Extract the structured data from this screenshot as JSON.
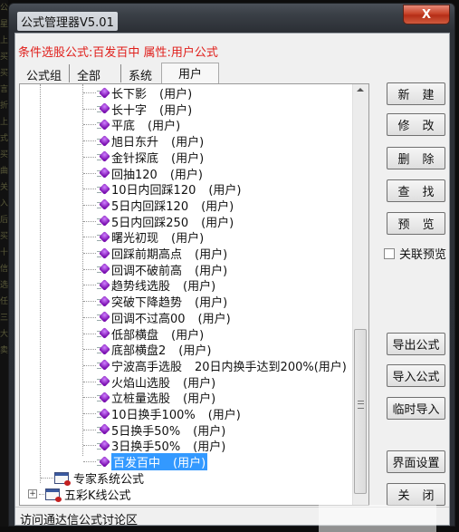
{
  "background_text": [
    "公",
    "星",
    "上",
    "买",
    "买",
    "言",
    "折",
    "上",
    "式",
    "买",
    "曲",
    "关",
    "入",
    "后",
    "买",
    "十",
    "信",
    "选",
    "任",
    "三",
    "大",
    "卖"
  ],
  "window": {
    "title": "公式管理器V5.01",
    "close_label": "X"
  },
  "condition_line": "条件选股公式:百发百中  属性:用户公式",
  "tabs": [
    {
      "label": "公式组"
    },
    {
      "label": "全部"
    },
    {
      "label": "系统"
    },
    {
      "label": "用户",
      "active": true
    }
  ],
  "tree": {
    "items": [
      {
        "name": "长下影",
        "tag": "(用户)"
      },
      {
        "name": "长十字",
        "tag": "(用户)"
      },
      {
        "name": "平底",
        "tag": "(用户)"
      },
      {
        "name": "旭日东升",
        "tag": "(用户)"
      },
      {
        "name": "金针探底",
        "tag": "(用户)"
      },
      {
        "name": "回抽120",
        "tag": "(用户)"
      },
      {
        "name": "10日内回踩120",
        "tag": "(用户)"
      },
      {
        "name": "5日内回踩120",
        "tag": "(用户)"
      },
      {
        "name": "5日内回踩250",
        "tag": "(用户)"
      },
      {
        "name": "曙光初现",
        "tag": "(用户)"
      },
      {
        "name": "回踩前期高点",
        "tag": "(用户)"
      },
      {
        "name": "回调不破前高",
        "tag": "(用户)"
      },
      {
        "name": "趋势线选股",
        "tag": "(用户)"
      },
      {
        "name": "突破下降趋势",
        "tag": "(用户)"
      },
      {
        "name": "回调不过高00",
        "tag": "(用户)"
      },
      {
        "name": "低部横盘",
        "tag": "(用户)"
      },
      {
        "name": "底部横盘2",
        "tag": "(用户)"
      },
      {
        "name": "宁波高手选股",
        "tag": "20日内换手达到200%(用户)"
      },
      {
        "name": "火焰山选股",
        "tag": "(用户)"
      },
      {
        "name": "立桩量选股",
        "tag": "(用户)"
      },
      {
        "name": "10日换手100%",
        "tag": "(用户)"
      },
      {
        "name": "5日换手50%",
        "tag": "(用户)"
      },
      {
        "name": "3日换手50%",
        "tag": "(用户)"
      },
      {
        "name": "百发百中",
        "tag": "(用户)",
        "selected": true
      }
    ],
    "groups": [
      {
        "label": "专家系统公式",
        "expandable": false
      },
      {
        "label": "五彩K线公式",
        "expandable": true,
        "expander": "+"
      }
    ],
    "scroll_position_fraction": 1.0
  },
  "buttons": {
    "new": "新建",
    "edit": "修改",
    "delete": "删除",
    "find": "查找",
    "preview": "预览",
    "export": "导出公式",
    "import": "导入公式",
    "temp_import": "临时导入",
    "ui_settings": "界面设置",
    "close": "关闭"
  },
  "linked_preview": {
    "label": "关联预览",
    "checked": false
  },
  "status_bar": "访问通达信公式讨论区",
  "colors": {
    "condition_text": "#e0201c",
    "selection": "#3399ff",
    "close_button": "#c8432a"
  }
}
